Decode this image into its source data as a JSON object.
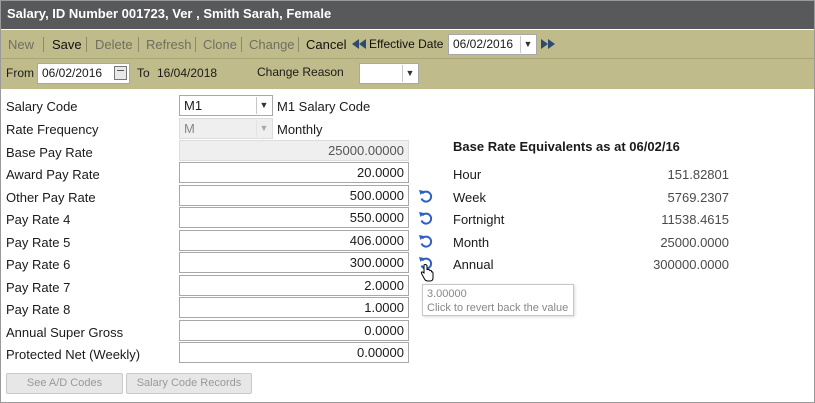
{
  "title": "Salary, ID Number 001723, Ver , Smith Sarah, Female",
  "toolbar": {
    "new": "New",
    "save": "Save",
    "delete": "Delete",
    "refresh": "Refresh",
    "clone": "Clone",
    "change": "Change",
    "cancel": "Cancel",
    "effective_date_label": "Effective Date",
    "effective_date": "06/02/2016"
  },
  "range": {
    "from_label": "From",
    "from_value": "06/02/2016",
    "to_label": "To",
    "to_value": "16/04/2018",
    "change_reason_label": "Change Reason",
    "change_reason_value": ""
  },
  "form": {
    "salary_code_label": "Salary Code",
    "salary_code_value": "M1",
    "salary_code_desc": "M1 Salary Code",
    "rate_frequency_label": "Rate Frequency",
    "rate_frequency_value": "M",
    "rate_frequency_desc": "Monthly",
    "fields": [
      {
        "label": "Base Pay Rate",
        "value": "25000.00000"
      },
      {
        "label": "Award Pay Rate",
        "value": "20.0000"
      },
      {
        "label": "Other Pay Rate",
        "value": "500.0000"
      },
      {
        "label": "Pay Rate 4",
        "value": "550.0000"
      },
      {
        "label": "Pay Rate 5",
        "value": "406.0000"
      },
      {
        "label": "Pay Rate 6",
        "value": "300.0000"
      },
      {
        "label": "Pay Rate 7",
        "value": "2.0000"
      },
      {
        "label": "Pay Rate 8",
        "value": "1.0000"
      },
      {
        "label": "Annual Super Gross",
        "value": "0.0000"
      },
      {
        "label": "Protected Net (Weekly)",
        "value": "0.00000"
      }
    ]
  },
  "equivalents": {
    "title": "Base Rate Equivalents as at 06/02/16",
    "rows": [
      {
        "label": "Hour",
        "value": "151.82801"
      },
      {
        "label": "Week",
        "value": "5769.2307"
      },
      {
        "label": "Fortnight",
        "value": "11538.4615"
      },
      {
        "label": "Month",
        "value": "25000.0000"
      },
      {
        "label": "Annual",
        "value": "300000.0000"
      }
    ]
  },
  "tooltip": {
    "value": "3.00000",
    "text": "Click to revert back the value"
  },
  "buttons": {
    "see_ad_codes": "See A/D Codes",
    "salary_code_records": "Salary Code Records"
  },
  "colors": {
    "title_bg": "#58595b",
    "toolbar_bg": "#bfbb8a",
    "revert_icon": "#2f5fc4"
  }
}
